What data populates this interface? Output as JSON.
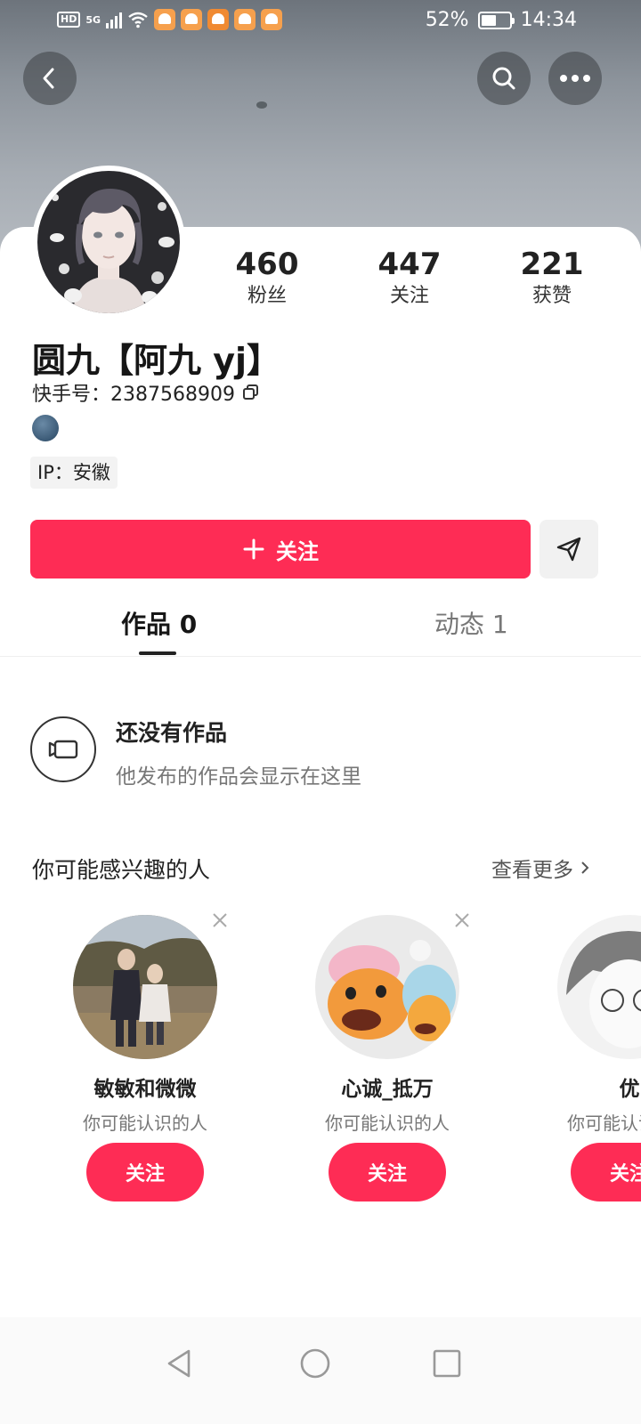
{
  "status_bar": {
    "hd": "HD",
    "network": "5G",
    "battery_percent": "52%",
    "battery_level": 0.52,
    "time": "14:34"
  },
  "header": {
    "back_icon": "chevron-left-icon",
    "search_icon": "search-icon",
    "more_icon": "more-horizontal-icon"
  },
  "profile": {
    "name": "圆九【阿九 yj】",
    "id_label": "快手号：",
    "id_value": "2387568909",
    "ip": "IP：安徽",
    "stats": [
      {
        "num": "460",
        "label": "粉丝"
      },
      {
        "num": "447",
        "label": "关注"
      },
      {
        "num": "221",
        "label": "获赞"
      }
    ]
  },
  "actions": {
    "follow_label": "关注",
    "follow_icon": "plus-icon",
    "share_icon": "send-icon"
  },
  "tabs": [
    {
      "label": "作品 0",
      "active": true
    },
    {
      "label": "动态 1",
      "active": false
    }
  ],
  "empty_state": {
    "title": "还没有作品",
    "subtitle": "他发布的作品会显示在这里"
  },
  "suggestions": {
    "title": "你可能感兴趣的人",
    "see_more": "查看更多",
    "people": [
      {
        "name": "敏敏和微微",
        "sub": "你可能认识的人",
        "button": "关注"
      },
      {
        "name": "心诚_抵万",
        "sub": "你可能认识的人",
        "button": "关注"
      },
      {
        "name": "优",
        "sub": "你可能认识的人",
        "button": "关注"
      }
    ]
  },
  "colors": {
    "accent": "#fe2c55",
    "text": "#222222",
    "muted": "#777777"
  }
}
